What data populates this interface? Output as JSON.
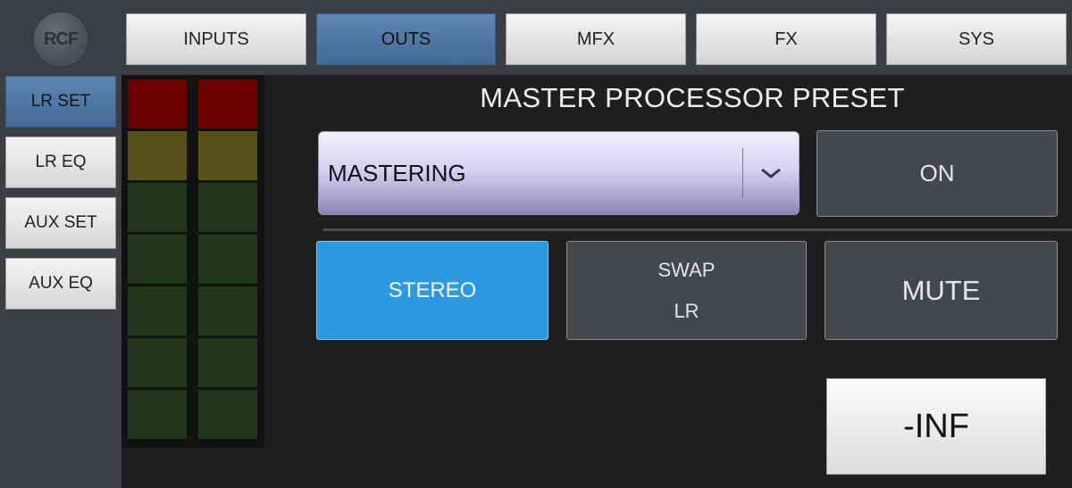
{
  "logo": {
    "text": "RCF"
  },
  "tabs": [
    {
      "label": "INPUTS",
      "active": false
    },
    {
      "label": "OUTS",
      "active": true
    },
    {
      "label": "MFX",
      "active": false
    },
    {
      "label": "FX",
      "active": false
    },
    {
      "label": "SYS",
      "active": false
    }
  ],
  "sidebar": [
    {
      "label": "LR SET",
      "active": true
    },
    {
      "label": "LR EQ",
      "active": false
    },
    {
      "label": "AUX SET",
      "active": false
    },
    {
      "label": "AUX EQ",
      "active": false
    }
  ],
  "meters": {
    "colors": {
      "red": "#6b0000",
      "yellow": "#555118",
      "green": "#213719"
    },
    "segments": [
      "red",
      "yellow",
      "green",
      "green",
      "green",
      "green",
      "green"
    ]
  },
  "preset": {
    "title": "MASTER PROCESSOR PRESET",
    "selected": "MASTERING",
    "on_label": "ON"
  },
  "controls": {
    "stereo_label": "STEREO",
    "swap_line1": "SWAP",
    "swap_line2": "LR",
    "mute_label": "MUTE"
  },
  "level": {
    "readout": "-INF"
  }
}
